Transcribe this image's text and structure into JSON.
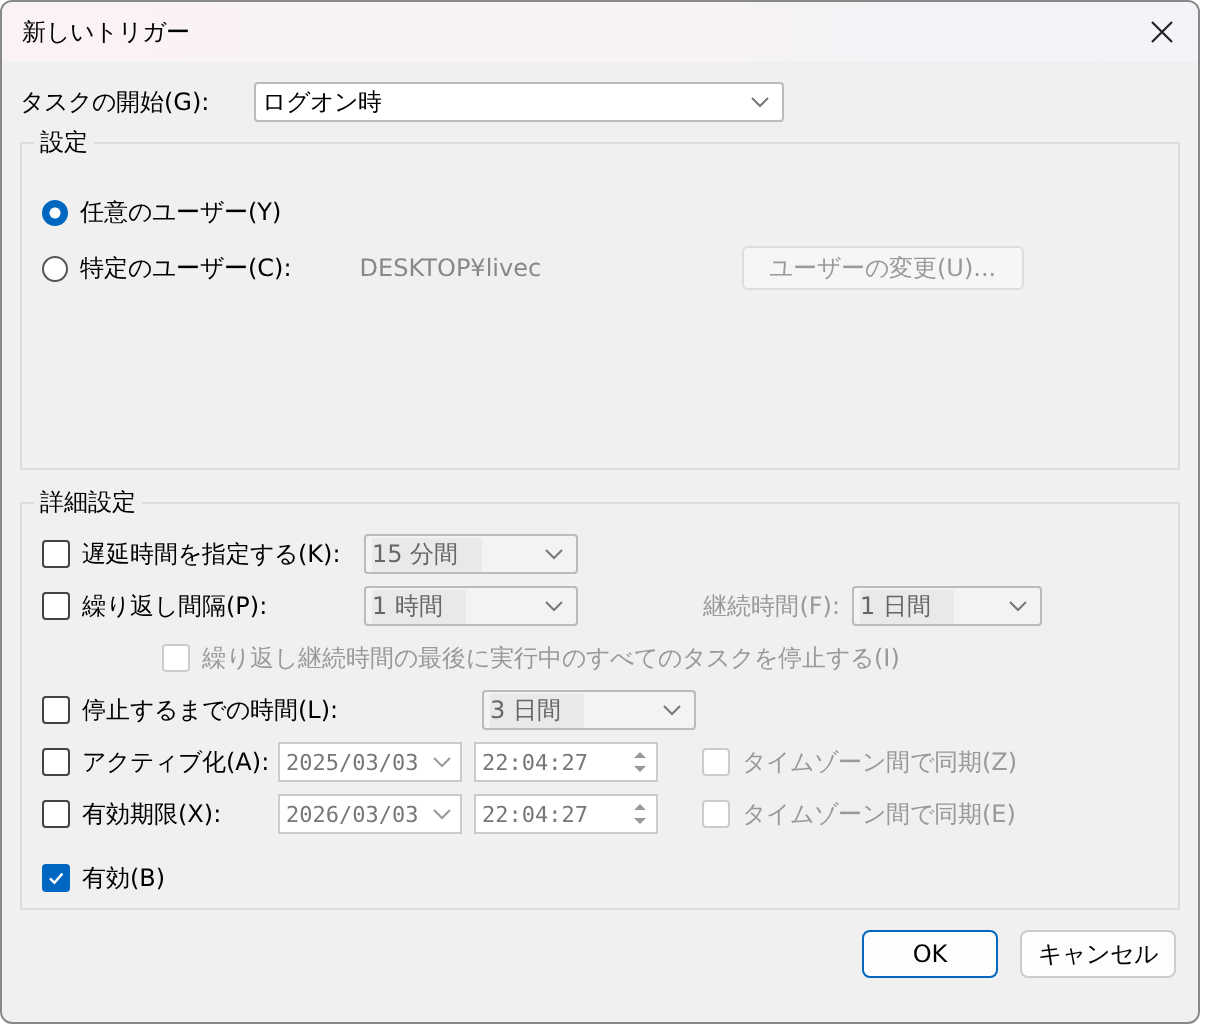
{
  "window": {
    "title": "新しいトリガー"
  },
  "task_start": {
    "label": "タスクの開始(G):",
    "value": "ログオン時"
  },
  "settings": {
    "title": "設定",
    "options": [
      {
        "label": "任意のユーザー(Y)",
        "selected": true
      },
      {
        "label": "特定のユーザー(C):",
        "selected": false
      }
    ],
    "user": "DESKTOP¥livec",
    "change_user_button": {
      "label": "ユーザーの変更(U)...",
      "disabled": true
    }
  },
  "advanced": {
    "title": "詳細設定",
    "delay": {
      "label": "遅延時間を指定する(K):",
      "checked": false,
      "value": "15 分間",
      "field_disabled": true
    },
    "repeat": {
      "label": "繰り返し間隔(P):",
      "checked": false,
      "value": "1 時間",
      "field_disabled": true,
      "duration": {
        "label": "継続時間(F):",
        "value": "1 日間",
        "disabled": true
      },
      "stop_all": {
        "label": "繰り返し継続時間の最後に実行中のすべてのタスクを停止する(I)",
        "checked": false,
        "disabled": true
      }
    },
    "stop_after": {
      "label": "停止するまでの時間(L):",
      "checked": false,
      "value": "3 日間",
      "field_disabled": true
    },
    "activate": {
      "label": "アクティブ化(A):",
      "checked": false,
      "date": "2025/03/03",
      "time": "22:04:27",
      "field_disabled": true,
      "sync": {
        "label": "タイムゾーン間で同期(Z)",
        "checked": false,
        "disabled": true
      }
    },
    "expire": {
      "label": "有効期限(X):",
      "checked": false,
      "date": "2026/03/03",
      "time": "22:04:27",
      "field_disabled": true,
      "sync": {
        "label": "タイムゾーン間で同期(E)",
        "checked": false,
        "disabled": true
      }
    },
    "enabled": {
      "label": "有効(B)",
      "checked": true
    }
  },
  "buttons": [
    {
      "label": "OK",
      "default": true
    },
    {
      "label": "キャンセル",
      "default": false
    }
  ]
}
